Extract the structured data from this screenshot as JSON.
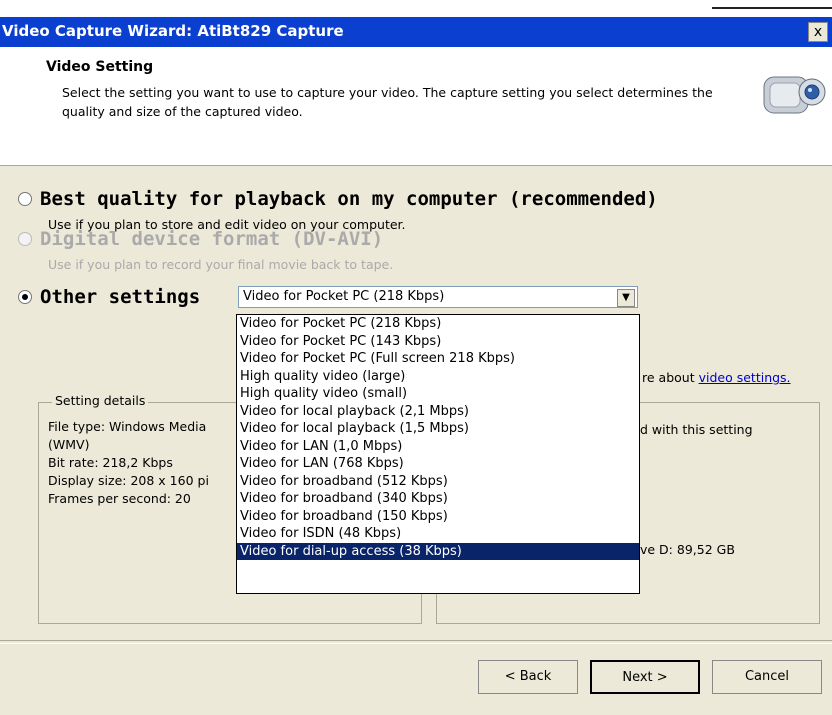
{
  "window": {
    "title": "Video Capture Wizard: AtiBt829 Capture",
    "close_label": "x"
  },
  "header": {
    "title": "Video Setting",
    "description": "Select the setting you want to use to capture your video. The capture setting you select determines the quality and size of the captured video."
  },
  "options": [
    {
      "title": "Best quality for playback on my computer (recommended)",
      "desc": "Use if you plan to store and edit video on your computer.",
      "selected": false,
      "disabled": false
    },
    {
      "title": "Digital device format (DV-AVI)",
      "desc": "Use if you plan to record your final movie back to tape.",
      "selected": false,
      "disabled": true
    },
    {
      "title": "Other settings",
      "selected": true,
      "disabled": false
    }
  ],
  "select": {
    "value": "Video for Pocket PC (218 Kbps)",
    "arrow": "▼"
  },
  "dropdown_items": [
    "Video for Pocket PC (218 Kbps)",
    "Video for Pocket PC (143 Kbps)",
    "Video for Pocket PC (Full screen 218 Kbps)",
    "High quality video (large)",
    "High quality video (small)",
    "Video for local playback (2,1 Mbps)",
    "Video for local playback (1,5 Mbps)",
    "Video for LAN (1,0 Mbps)",
    "Video for LAN (768 Kbps)",
    "Video for broadband (512 Kbps)",
    "Video for broadband (340 Kbps)",
    "Video for broadband (150 Kbps)",
    "Video for ISDN (48 Kbps)",
    "Video for dial-up access (38 Kbps)"
  ],
  "learn_more": {
    "prefix": "re about",
    "link": "video settings."
  },
  "setting_details": {
    "label": "Setting details",
    "text": "File type: Windows Media\n(WMV)\nBit rate: 218,2 Kbps\nDisplay size: 208 x 160 pi\nFrames per second: 20"
  },
  "right_panel": {
    "line1": "d with this setting",
    "line2": "ve D: 89,52 GB"
  },
  "buttons": {
    "back": "< Back",
    "next": "Next >",
    "cancel": "Cancel"
  }
}
